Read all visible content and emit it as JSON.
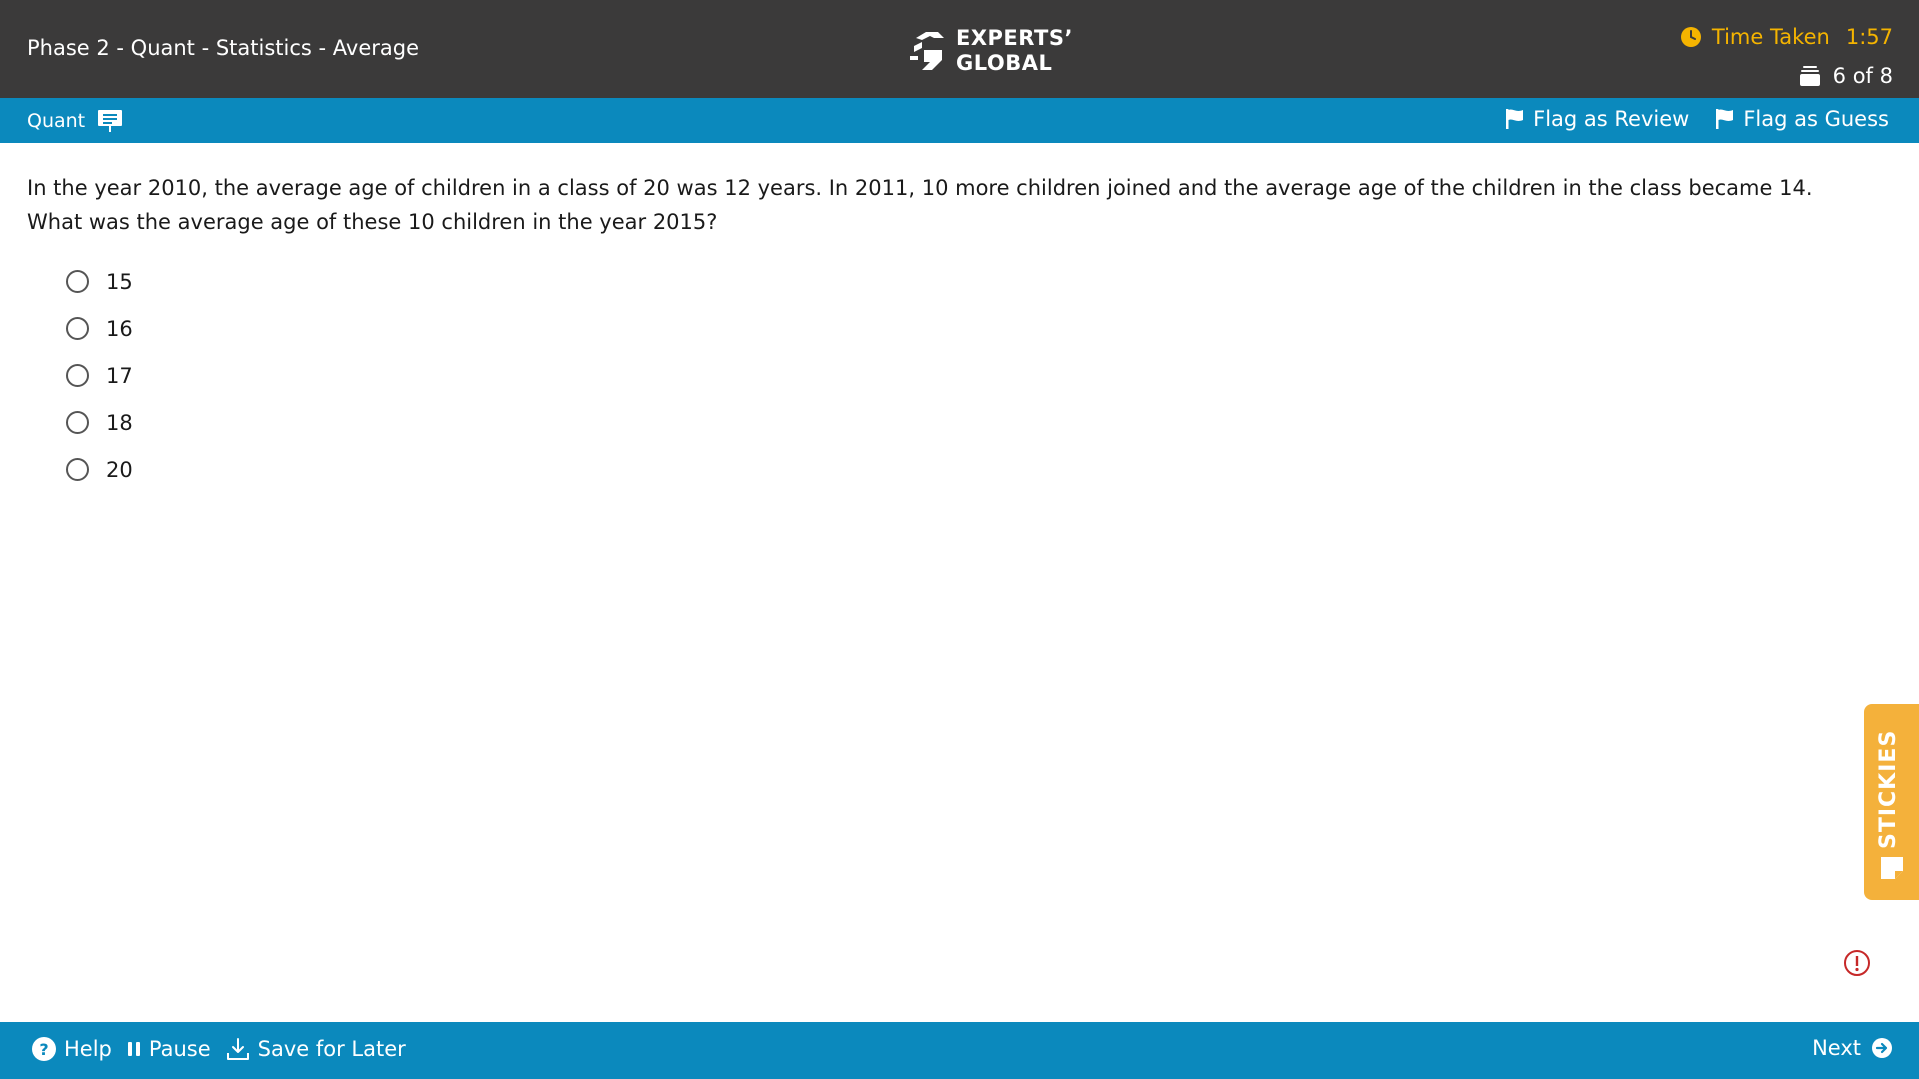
{
  "header": {
    "title": "Phase 2 - Quant - Statistics - Average",
    "logo_line1": "EXPERTS’",
    "logo_line2": "GLOBAL",
    "timer_label": "Time Taken",
    "timer_value": "1:57",
    "progress": "6 of 8"
  },
  "subbar": {
    "section": "Quant",
    "flag_review": "Flag as Review",
    "flag_guess": "Flag as Guess"
  },
  "question": {
    "text": "In the year 2010, the average age of children in a class of 20 was 12 years. In 2011, 10 more children joined and the average age of the children in the class became 14. What was the average age of these 10 children in the year 2015?",
    "options": [
      "15",
      "16",
      "17",
      "18",
      "20"
    ]
  },
  "stickies": {
    "label": "STICKIES"
  },
  "footer": {
    "help": "Help",
    "pause": "Pause",
    "save": "Save for Later",
    "next": "Next"
  },
  "colors": {
    "header_bg": "#3b3a3a",
    "accent_blue": "#0b89bd",
    "timer_yellow": "#f5b400",
    "stickies_orange": "#f4b13b",
    "alert_red": "#c62828"
  }
}
